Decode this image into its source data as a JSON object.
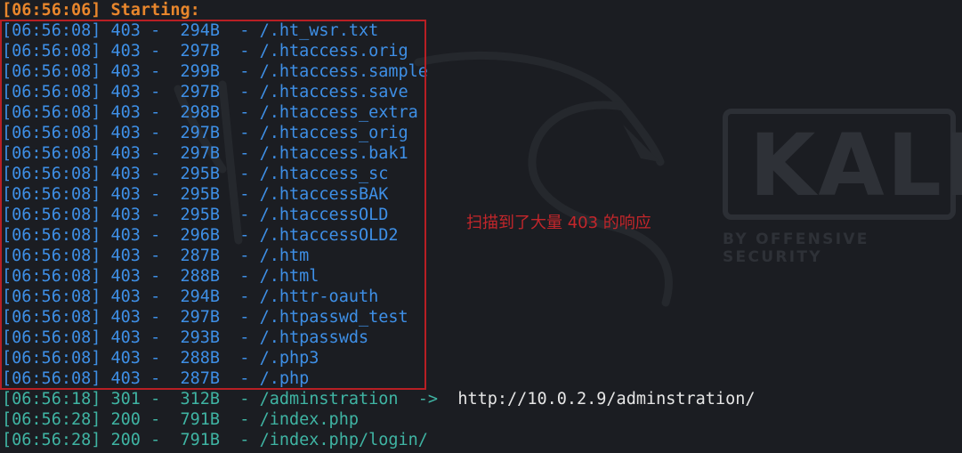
{
  "watermark": {
    "logo_text": "KALI",
    "tagline": "BY OFFENSIVE SECURITY"
  },
  "colors": {
    "background": "#1b1d22",
    "start_line": "#e8862c",
    "status_403": "#3e8fe6",
    "status_ok": "#3fb4a3",
    "redirect_target": "#e6e6e6",
    "highlight_box": "#b81f24",
    "annotation": "#c3262b"
  },
  "terminal": {
    "start_line": "[06:56:06] Starting:",
    "forbidden_lines": [
      "[06:56:08] 403 -  294B  - /.ht_wsr.txt",
      "[06:56:08] 403 -  297B  - /.htaccess.orig",
      "[06:56:08] 403 -  299B  - /.htaccess.sample",
      "[06:56:08] 403 -  297B  - /.htaccess.save",
      "[06:56:08] 403 -  298B  - /.htaccess_extra",
      "[06:56:08] 403 -  297B  - /.htaccess_orig",
      "[06:56:08] 403 -  297B  - /.htaccess.bak1",
      "[06:56:08] 403 -  295B  - /.htaccess_sc",
      "[06:56:08] 403 -  295B  - /.htaccessBAK",
      "[06:56:08] 403 -  295B  - /.htaccessOLD",
      "[06:56:08] 403 -  296B  - /.htaccessOLD2",
      "[06:56:08] 403 -  287B  - /.htm",
      "[06:56:08] 403 -  288B  - /.html",
      "[06:56:08] 403 -  294B  - /.httr-oauth",
      "[06:56:08] 403 -  297B  - /.htpasswd_test",
      "[06:56:08] 403 -  293B  - /.htpasswds",
      "[06:56:08] 403 -  288B  - /.php3",
      "[06:56:08] 403 -  287B  - /.php"
    ],
    "redirect_line": {
      "text": "[06:56:18] 301 -  312B  - /adminstration  ->",
      "target": "  http://10.0.2.9/adminstration/"
    },
    "ok_lines": [
      "[06:56:28] 200 -  791B  - /index.php",
      "[06:56:28] 200 -  791B  - /index.php/login/"
    ]
  },
  "annotation": "扫描到了大量 403 的响应"
}
